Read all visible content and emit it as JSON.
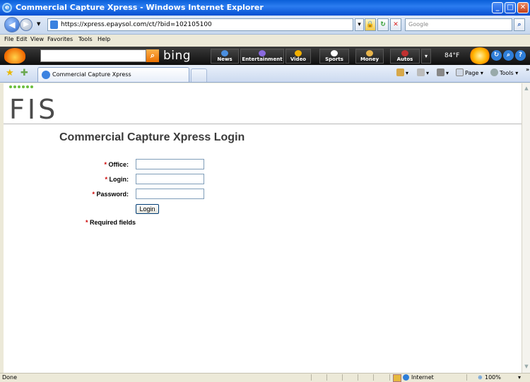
{
  "window": {
    "title": "Commercial Capture Xpress - Windows Internet Explorer",
    "minimize_glyph": "_",
    "maximize_glyph": "□",
    "close_glyph": "✕"
  },
  "address": {
    "url": "https://xpress.epaysol.com/ct/?bid=102105100",
    "search_placeholder": "Google"
  },
  "menu": [
    "File",
    "Edit",
    "View",
    "Favorites",
    "Tools",
    "Help"
  ],
  "bing": {
    "logo": "bing",
    "tabs": [
      {
        "label": "News",
        "color": "#4a8fe0"
      },
      {
        "label": "Entertainment",
        "color": "#8a6adf"
      },
      {
        "label": "Video",
        "color": "#f2b000"
      },
      {
        "label": "Sports",
        "color": "#ffffff"
      },
      {
        "label": "Money",
        "color": "#e8b44a"
      },
      {
        "label": "Autos",
        "color": "#c03030"
      }
    ],
    "temperature": "84°F"
  },
  "tabs": {
    "active_label": "Commercial Capture Xpress",
    "page_label": "Page",
    "tools_label": "Tools"
  },
  "page": {
    "logo": "FIS",
    "title": "Commercial Capture Xpress Login",
    "required_mark": "*",
    "fields": {
      "office": {
        "label": "Office:",
        "value": ""
      },
      "login": {
        "label": "Login:",
        "value": ""
      },
      "password": {
        "label": "Password:",
        "value": ""
      }
    },
    "login_button": "Login",
    "required_note": "Required fields"
  },
  "status": {
    "text": "Done",
    "zone": "Internet",
    "zoom": "100%"
  },
  "colors": {
    "required": "#cc0000",
    "logo_dots": "#6cbf3f",
    "title_bar": "#0a5fd8"
  }
}
